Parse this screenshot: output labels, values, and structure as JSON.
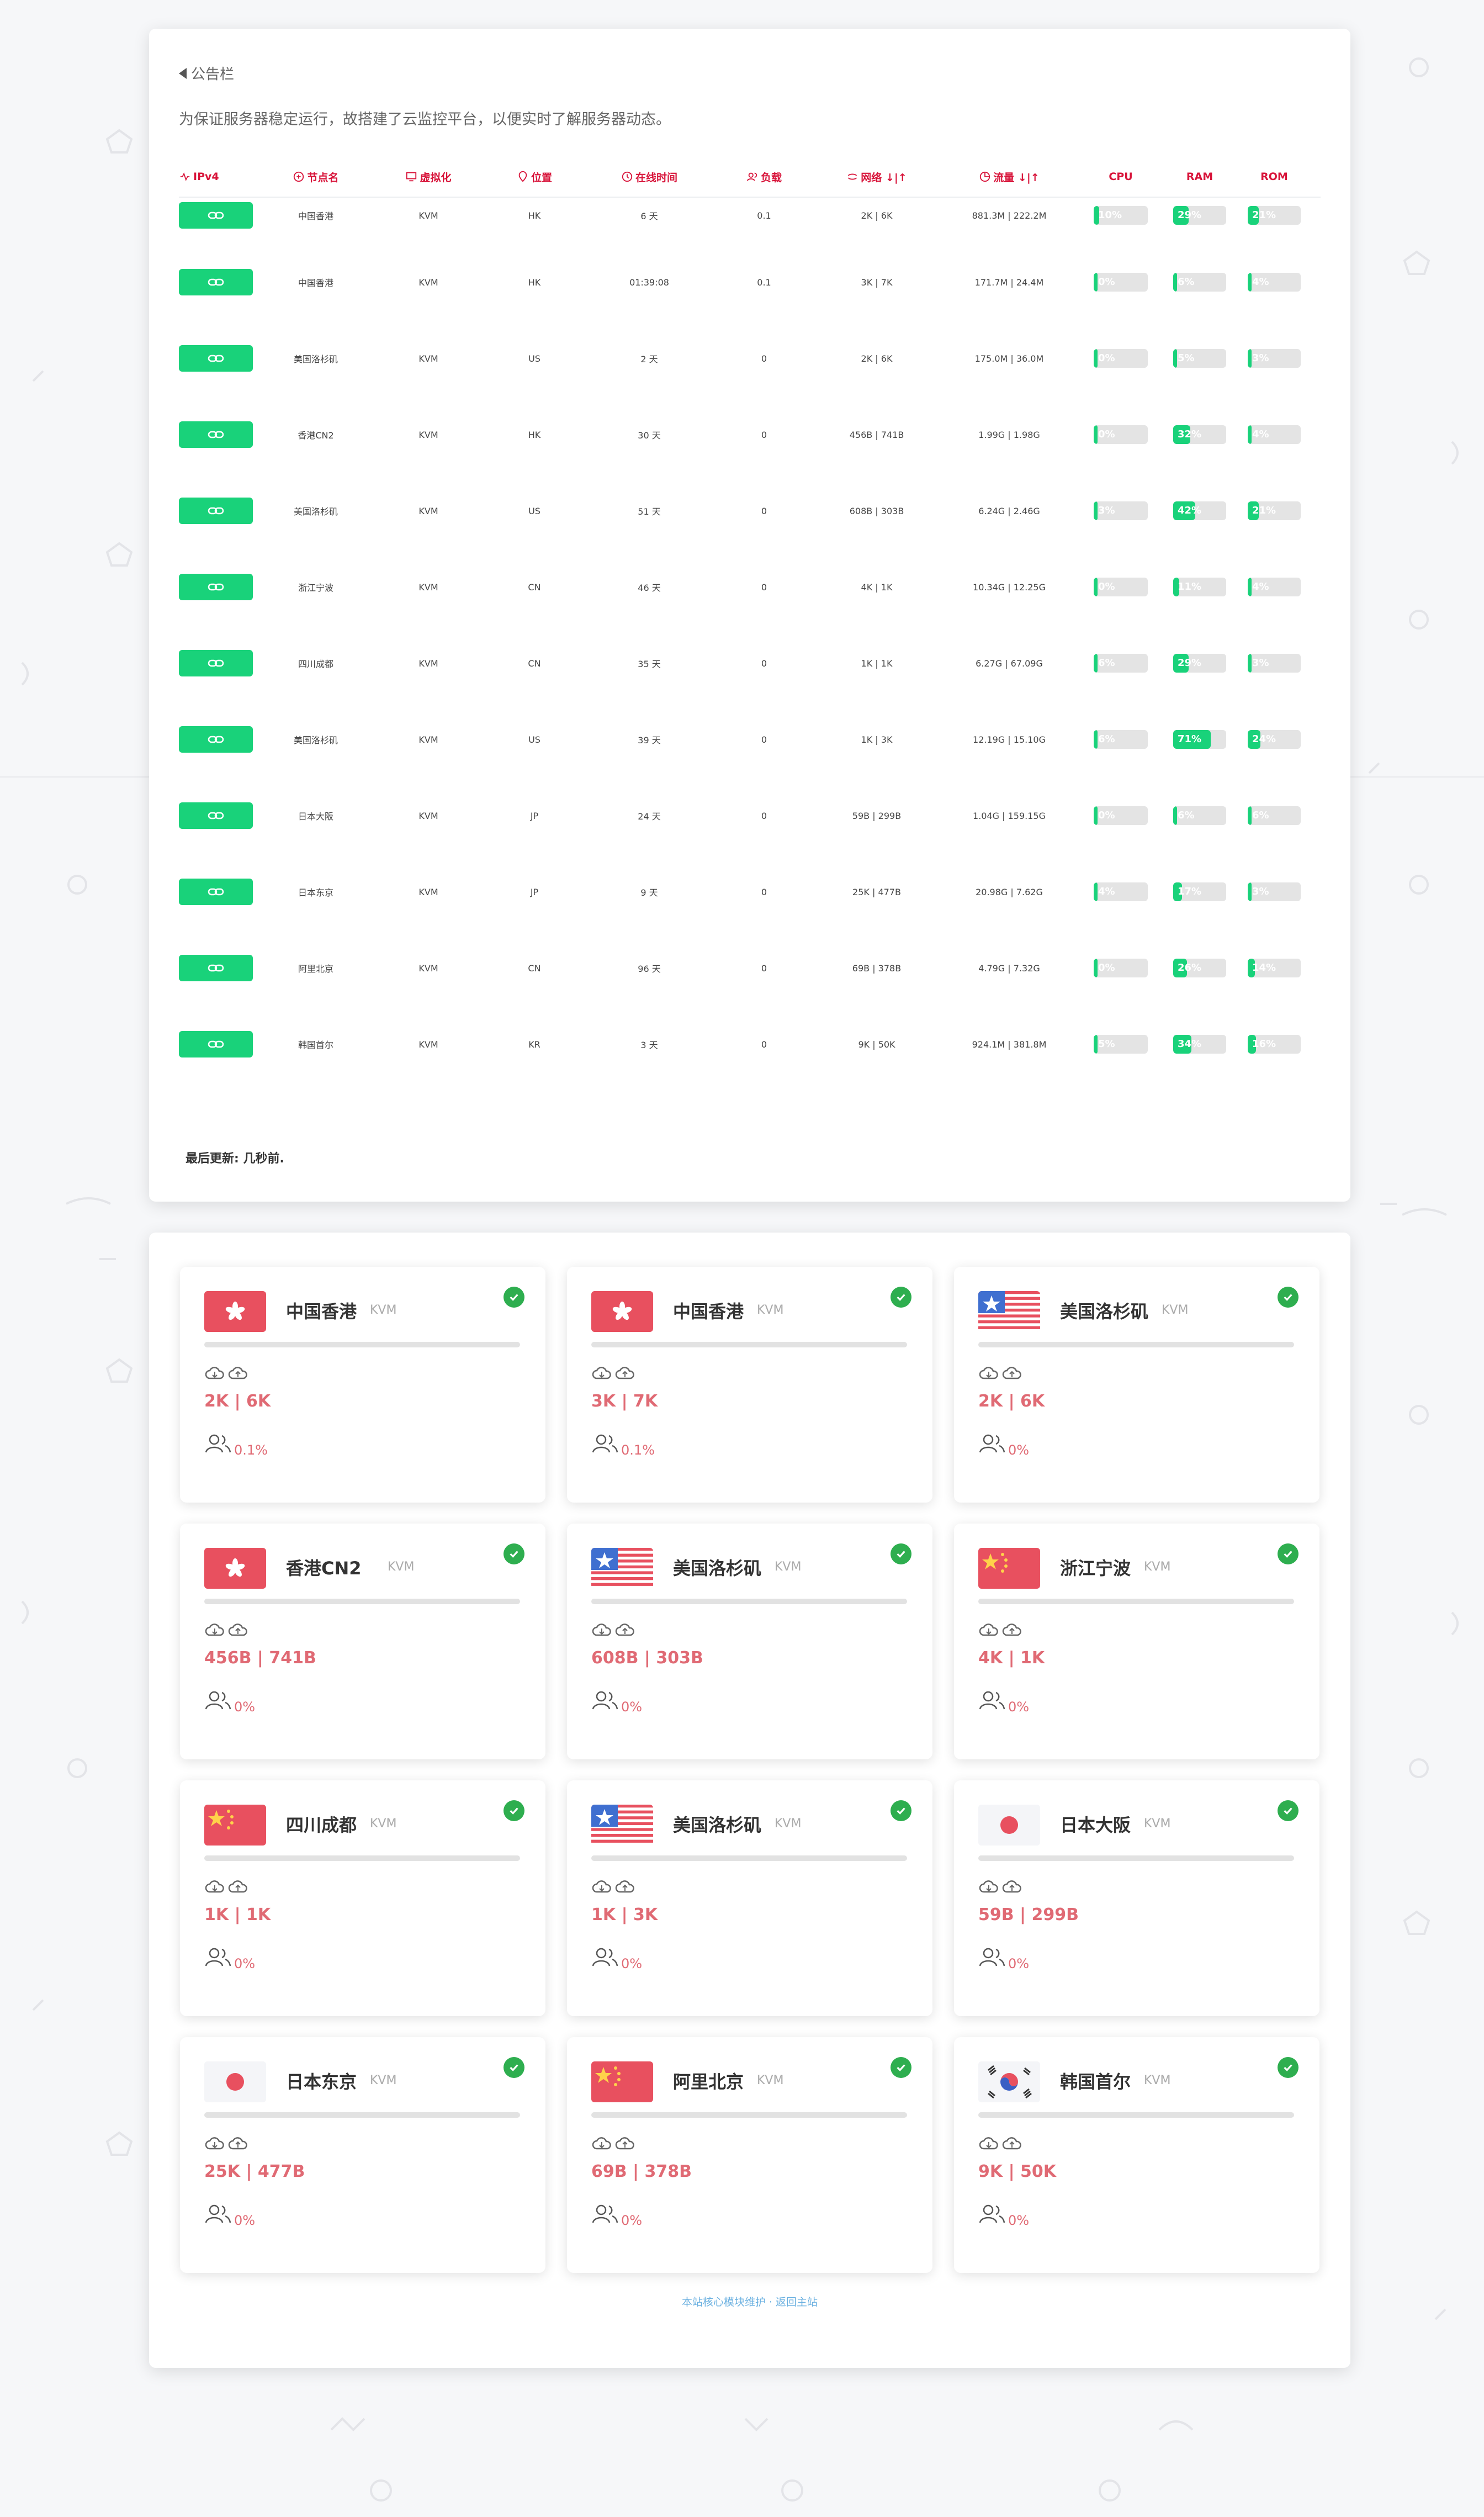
{
  "notice": {
    "title": "公告栏",
    "text": "为保证服务器稳定运行，故搭建了云监控平台，以便实时了解服务器动态。"
  },
  "table": {
    "headers": [
      "IPv4",
      "节点名",
      "虚拟化",
      "位置",
      "在线时间",
      "负载",
      "网络 ↓|↑",
      "流量 ↓|↑",
      "CPU",
      "RAM",
      "ROM"
    ],
    "rows": [
      {
        "name": "中国香港",
        "virt": "KVM",
        "loc": "HK",
        "uptime": "6 天",
        "load": "0.1",
        "net": "2K | 6K",
        "traffic": "881.3M | 222.2M",
        "cpu": 10,
        "ram": 29,
        "rom": 21
      },
      {
        "name": "中国香港",
        "virt": "KVM",
        "loc": "HK",
        "uptime": "01:39:08",
        "load": "0.1",
        "net": "3K | 7K",
        "traffic": "171.7M | 24.4M",
        "cpu": 0,
        "ram": 6,
        "rom": 4
      },
      {
        "name": "美国洛杉矶",
        "virt": "KVM",
        "loc": "US",
        "uptime": "2 天",
        "load": "0",
        "net": "2K | 6K",
        "traffic": "175.0M | 36.0M",
        "cpu": 0,
        "ram": 5,
        "rom": 3
      },
      {
        "name": "香港CN2",
        "virt": "KVM",
        "loc": "HK",
        "uptime": "30 天",
        "load": "0",
        "net": "456B | 741B",
        "traffic": "1.99G | 1.98G",
        "cpu": 0,
        "ram": 32,
        "rom": 4
      },
      {
        "name": "美国洛杉矶",
        "virt": "KVM",
        "loc": "US",
        "uptime": "51 天",
        "load": "0",
        "net": "608B | 303B",
        "traffic": "6.24G | 2.46G",
        "cpu": 3,
        "ram": 42,
        "rom": 21
      },
      {
        "name": "浙江宁波",
        "virt": "KVM",
        "loc": "CN",
        "uptime": "46 天",
        "load": "0",
        "net": "4K | 1K",
        "traffic": "10.34G | 12.25G",
        "cpu": 0,
        "ram": 11,
        "rom": 4
      },
      {
        "name": "四川成都",
        "virt": "KVM",
        "loc": "CN",
        "uptime": "35 天",
        "load": "0",
        "net": "1K | 1K",
        "traffic": "6.27G | 67.09G",
        "cpu": 6,
        "ram": 29,
        "rom": 3
      },
      {
        "name": "美国洛杉矶",
        "virt": "KVM",
        "loc": "US",
        "uptime": "39 天",
        "load": "0",
        "net": "1K | 3K",
        "traffic": "12.19G | 15.10G",
        "cpu": 6,
        "ram": 71,
        "rom": 24
      },
      {
        "name": "日本大阪",
        "virt": "KVM",
        "loc": "JP",
        "uptime": "24 天",
        "load": "0",
        "net": "59B | 299B",
        "traffic": "1.04G | 159.15G",
        "cpu": 0,
        "ram": 6,
        "rom": 6
      },
      {
        "name": "日本东京",
        "virt": "KVM",
        "loc": "JP",
        "uptime": "9 天",
        "load": "0",
        "net": "25K | 477B",
        "traffic": "20.98G | 7.62G",
        "cpu": 4,
        "ram": 17,
        "rom": 3
      },
      {
        "name": "阿里北京",
        "virt": "KVM",
        "loc": "CN",
        "uptime": "96 天",
        "load": "0",
        "net": "69B | 378B",
        "traffic": "4.79G | 7.32G",
        "cpu": 0,
        "ram": 26,
        "rom": 14
      },
      {
        "name": "韩国首尔",
        "virt": "KVM",
        "loc": "KR",
        "uptime": "3 天",
        "load": "0",
        "net": "9K | 50K",
        "traffic": "924.1M | 381.8M",
        "cpu": 5,
        "ram": 34,
        "rom": 16
      }
    ],
    "updated": "最后更新: 几秒前."
  },
  "cards": [
    {
      "name": "中国香港",
      "virt": "KVM",
      "flag": "hk",
      "net": "2K | 6K",
      "load": "0.1%"
    },
    {
      "name": "中国香港",
      "virt": "KVM",
      "flag": "hk",
      "net": "3K | 7K",
      "load": "0.1%"
    },
    {
      "name": "美国洛杉矶",
      "virt": "KVM",
      "flag": "us",
      "net": "2K | 6K",
      "load": "0%"
    },
    {
      "name": "香港CN2",
      "virt": "KVM",
      "flag": "hk",
      "net": "456B | 741B",
      "load": "0%"
    },
    {
      "name": "美国洛杉矶",
      "virt": "KVM",
      "flag": "us",
      "net": "608B | 303B",
      "load": "0%"
    },
    {
      "name": "浙江宁波",
      "virt": "KVM",
      "flag": "cn",
      "net": "4K | 1K",
      "load": "0%"
    },
    {
      "name": "四川成都",
      "virt": "KVM",
      "flag": "cn",
      "net": "1K | 1K",
      "load": "0%"
    },
    {
      "name": "美国洛杉矶",
      "virt": "KVM",
      "flag": "us",
      "net": "1K | 3K",
      "load": "0%"
    },
    {
      "name": "日本大阪",
      "virt": "KVM",
      "flag": "jp",
      "net": "59B | 299B",
      "load": "0%"
    },
    {
      "name": "日本东京",
      "virt": "KVM",
      "flag": "jp",
      "net": "25K | 477B",
      "load": "0%"
    },
    {
      "name": "阿里北京",
      "virt": "KVM",
      "flag": "cn",
      "net": "69B | 378B",
      "load": "0%"
    },
    {
      "name": "韩国首尔",
      "virt": "KVM",
      "flag": "kr",
      "net": "9K | 50K",
      "load": "0%"
    }
  ],
  "footer": "本站核心模块维护 · 返回主站",
  "colors": {
    "accent": "#d8143a",
    "green": "#19d27a",
    "pink": "#e06a74",
    "check": "#2eae4f"
  }
}
